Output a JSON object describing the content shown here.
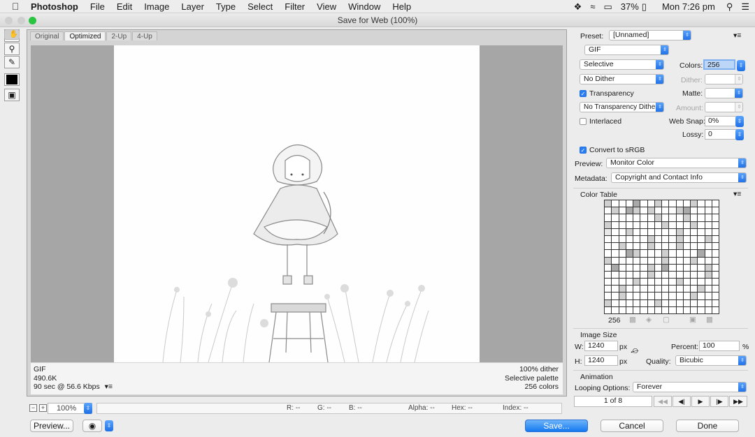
{
  "menubar": {
    "app": "Photoshop",
    "items": [
      "File",
      "Edit",
      "Image",
      "Layer",
      "Type",
      "Select",
      "Filter",
      "View",
      "Window",
      "Help"
    ],
    "battery": "37%",
    "clock": "Mon 7:26 pm"
  },
  "window": {
    "title": "Save for Web (100%)"
  },
  "tabs": [
    "Original",
    "Optimized",
    "2-Up",
    "4-Up"
  ],
  "info": {
    "format": "GIF",
    "size": "490.6K",
    "speed": "90 sec @ 56.6 Kbps",
    "dither": "100% dither",
    "palette": "Selective palette",
    "colors": "256 colors"
  },
  "bottom": {
    "zoom": "100%",
    "r": "R: --",
    "g": "G: --",
    "b": "B: --",
    "alpha": "Alpha: --",
    "hex": "Hex: --",
    "index": "Index: --"
  },
  "buttons": {
    "preview": "Preview...",
    "save": "Save...",
    "cancel": "Cancel",
    "done": "Done"
  },
  "panel": {
    "preset_label": "Preset:",
    "preset": "[Unnamed]",
    "format": "GIF",
    "reduction": "Selective",
    "colors_label": "Colors:",
    "colors": "256",
    "dither_algo": "No Dither",
    "dither_label": "Dither:",
    "transparency": "Transparency",
    "matte_label": "Matte:",
    "trans_dither": "No Transparency Dither",
    "amount_label": "Amount:",
    "interlaced": "Interlaced",
    "websnap_label": "Web Snap:",
    "websnap": "0%",
    "lossy_label": "Lossy:",
    "lossy": "0",
    "convert": "Convert to sRGB",
    "preview_label": "Preview:",
    "preview": "Monitor Color",
    "metadata_label": "Metadata:",
    "metadata": "Copyright and Contact Info",
    "color_table": "Color Table",
    "color_count": "256",
    "image_size": "Image Size",
    "w_label": "W:",
    "w": "1240",
    "h_label": "H:",
    "h": "1240",
    "px": "px",
    "percent_label": "Percent:",
    "percent": "100",
    "pct": "%",
    "quality_label": "Quality:",
    "quality": "Bicubic",
    "animation": "Animation",
    "looping_label": "Looping Options:",
    "looping": "Forever",
    "frame": "1 of 8"
  }
}
